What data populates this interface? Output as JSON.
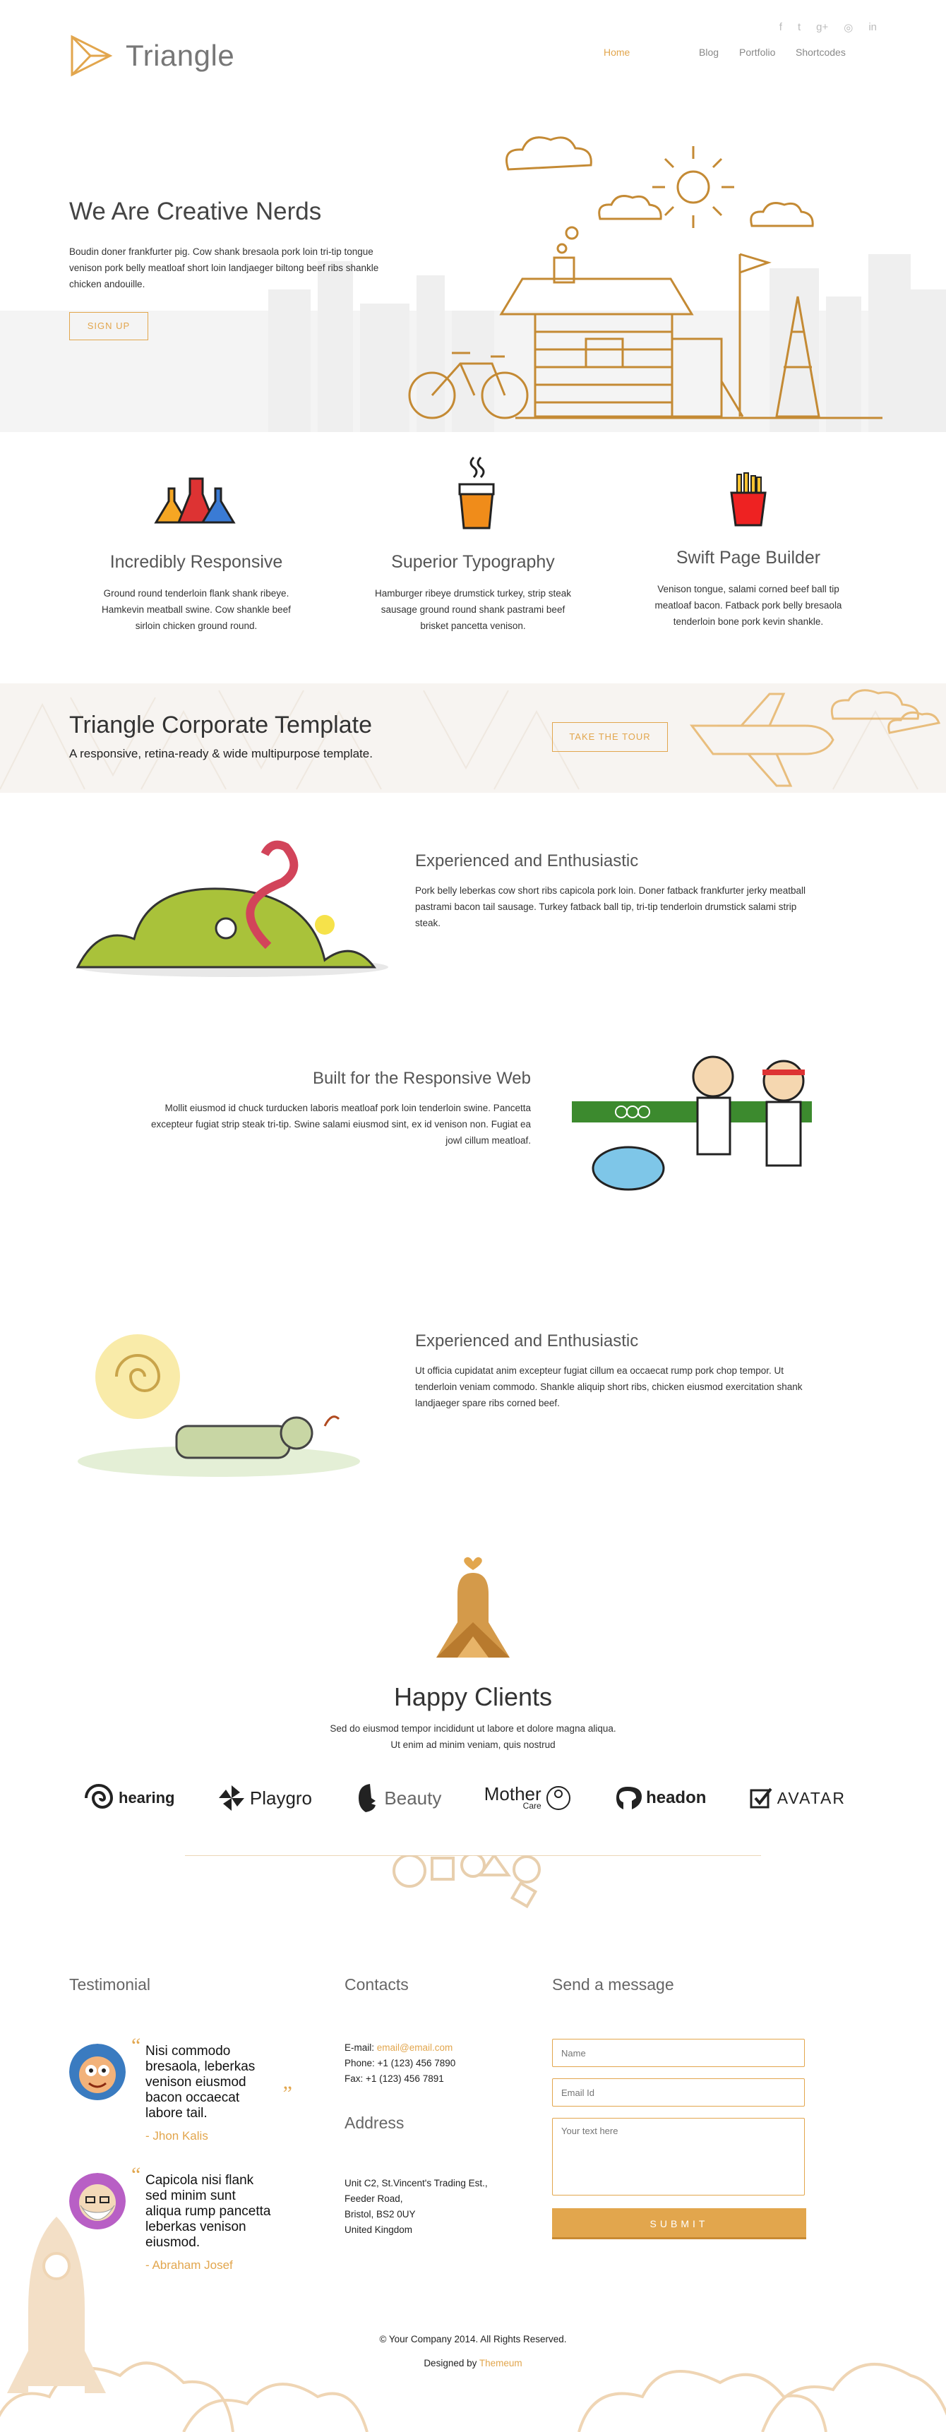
{
  "header": {
    "logo_text": "Triangle",
    "social_icons": [
      "facebook-icon",
      "twitter-icon",
      "google-plus-icon",
      "dribbble-icon",
      "linkedin-icon"
    ],
    "social_glyphs": [
      "f",
      "t",
      "g+",
      "◎",
      "in"
    ],
    "nav": [
      {
        "label": "Home",
        "active": true
      },
      {
        "label": "Blog",
        "active": false
      },
      {
        "label": "Portfolio",
        "active": false
      },
      {
        "label": "Shortcodes",
        "active": false
      }
    ]
  },
  "hero": {
    "title": "We Are Creative Nerds",
    "text": "Boudin doner frankfurter pig. Cow shank bresaola pork loin tri-tip tongue venison pork belly meatloaf short loin landjaeger biltong beef ribs shankle chicken andouille.",
    "button": "SIGN UP"
  },
  "features": [
    {
      "icon": "flasks-icon",
      "title": "Incredibly Responsive",
      "text": "Ground round tenderloin flank shank ribeye. Hamkevin meatball swine. Cow shankle beef sirloin chicken ground round."
    },
    {
      "icon": "coffee-cup-icon",
      "title": "Superior Typography",
      "text": "Hamburger ribeye drumstick turkey, strip steak sausage ground round shank pastrami beef brisket pancetta venison."
    },
    {
      "icon": "fries-icon",
      "title": "Swift Page Builder",
      "text": "Venison tongue, salami corned beef ball tip meatloaf bacon. Fatback pork belly bresaola tenderloin bone pork kevin shankle."
    }
  ],
  "banner": {
    "title": "Triangle Corporate Template",
    "subtitle": "A responsive, retina-ready & wide multipurpose template.",
    "button": "TAKE THE TOUR"
  },
  "sections": [
    {
      "title": "Experienced and Enthusiastic",
      "text": "Pork belly leberkas cow short ribs capicola pork loin. Doner fatback frankfurter jerky meatball pastrami bacon tail sausage. Turkey fatback ball tip, tri-tip tenderloin drumstick salami strip steak."
    },
    {
      "title": "Built for the Responsive Web",
      "text": "Mollit eiusmod id chuck turducken laboris meatloaf pork loin tenderloin swine. Pancetta excepteur fugiat strip steak tri-tip. Swine salami eiusmod sint, ex id venison non. Fugiat ea jowl cillum meatloaf."
    },
    {
      "title": "Experienced and Enthusiastic",
      "text": "Ut officia cupidatat anim excepteur fugiat cillum ea occaecat rump pork chop tempor. Ut tenderloin veniam commodo. Shankle aliquip short ribs, chicken eiusmod exercitation shank landjaeger spare ribs corned beef."
    }
  ],
  "clients": {
    "title": "Happy Clients",
    "text_line1": "Sed do eiusmod tempor incididunt ut labore et dolore magna aliqua.",
    "text_line2": "Ut enim ad minim veniam, quis nostrud",
    "logos": [
      "hearing",
      "Playgro",
      "Beauty",
      "Mother",
      "headon",
      "AVATAR"
    ],
    "logo_sub": "Care"
  },
  "testimonial": {
    "title": "Testimonial",
    "items": [
      {
        "quote": "Nisi commodo bresaola, leberkas venison eiusmod bacon occaecat labore tail.",
        "author": "- Jhon Kalis"
      },
      {
        "quote": "Capicola nisi flank sed minim sunt aliqua rump pancetta leberkas venison eiusmod.",
        "author": "- Abraham Josef"
      }
    ]
  },
  "contacts": {
    "title": "Contacts",
    "email_label": "E-mail:",
    "email": "email@email.com",
    "phone": "Phone: +1 (123) 456 7890",
    "fax": "Fax: +1 (123) 456 7891",
    "address_title": "Address",
    "address": [
      "Unit C2, St.Vincent's Trading Est.,",
      "Feeder Road,",
      "Bristol, BS2 0UY",
      "United Kingdom"
    ]
  },
  "message_form": {
    "title": "Send a message",
    "name_placeholder": "Name",
    "email_placeholder": "Email Id",
    "text_placeholder": "Your text here",
    "submit": "SUBMIT"
  },
  "footer": {
    "copyright": "© Your Company 2014. All Rights Reserved.",
    "designed_by": "Designed by",
    "designer": "Themeum"
  },
  "colors": {
    "accent": "#e2a64d",
    "accent_dark": "#b47c2c",
    "text": "#333333",
    "muted": "#f4f4f4"
  }
}
